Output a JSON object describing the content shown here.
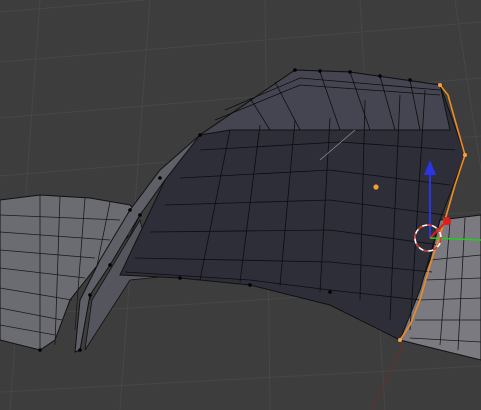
{
  "viewport": {
    "background_color": "#3d3d3d",
    "grid_color": "#474747",
    "mesh_face_color": "#4a4a58",
    "mesh_face_dark_color": "#2b2c36",
    "mesh_edge_color": "#0d0d0d",
    "selected_edge_color": "#f08a1f",
    "origin_dot_color": "#f0a030",
    "gizmo": {
      "z_axis_color": "#2a36e6",
      "x_axis_color": "#e21b1b",
      "y_axis_color": "#22cc22",
      "cursor_color": "#ffffff"
    },
    "icons": [
      "transform-gizmo-icon",
      "3d-cursor-icon",
      "object-origin-icon"
    ]
  }
}
